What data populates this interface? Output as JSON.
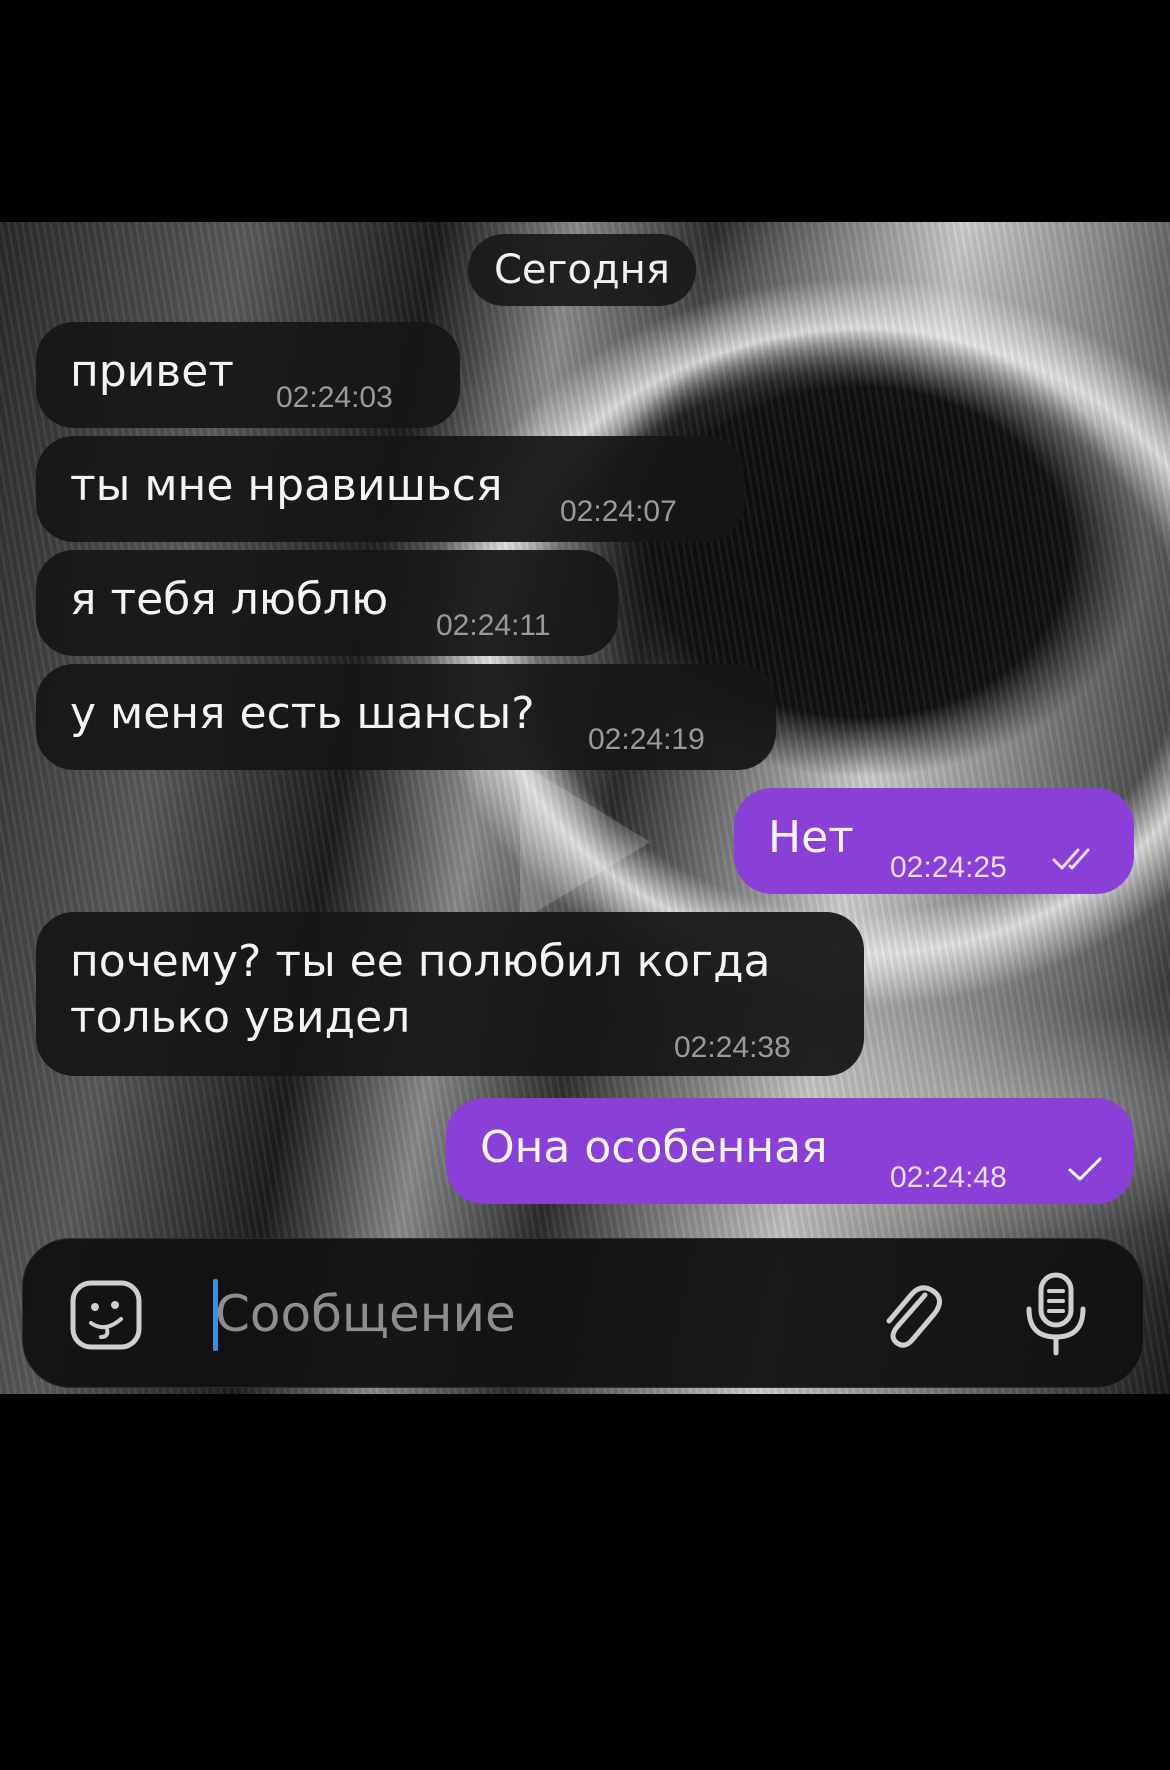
{
  "date_separator": "Сегодня",
  "messages": [
    {
      "direction": "incoming",
      "text": "привет",
      "time": "02:24:03"
    },
    {
      "direction": "incoming",
      "text": "ты мне нравишься",
      "time": "02:24:07"
    },
    {
      "direction": "incoming",
      "text": "я тебя люблю",
      "time": "02:24:11"
    },
    {
      "direction": "incoming",
      "text": "у меня есть шансы?",
      "time": "02:24:19"
    },
    {
      "direction": "outgoing",
      "text": "Нет",
      "time": "02:24:25",
      "status": "read"
    },
    {
      "direction": "incoming",
      "text": "почему? ты ее полюбил когда только увидел",
      "time": "02:24:38"
    },
    {
      "direction": "outgoing",
      "text": "Она особенная",
      "time": "02:24:48",
      "status": "sent"
    }
  ],
  "composer": {
    "placeholder": "Сообщение",
    "left_icon": "sticker-emoji-icon",
    "right_icons": [
      "paperclip-icon",
      "microphone-icon"
    ]
  },
  "colors": {
    "outgoing_bubble": "#8a3fd6",
    "incoming_bubble": "#161616",
    "cursor": "#3d8de0"
  }
}
